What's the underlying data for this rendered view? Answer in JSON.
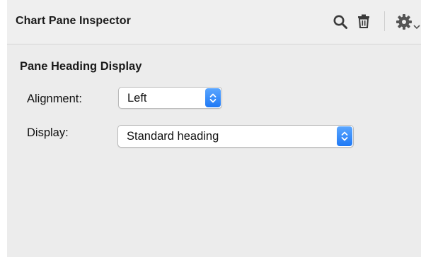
{
  "inspector": {
    "title": "Chart Pane Inspector"
  },
  "toolbar": {
    "icons": [
      "search-icon",
      "trash-icon",
      "gear-icon",
      "chevron-down-icon"
    ]
  },
  "section": {
    "title": "Pane Heading Display"
  },
  "fields": {
    "alignment": {
      "label": "Alignment:",
      "value": "Left"
    },
    "display": {
      "label": "Display:",
      "value": "Standard heading"
    }
  },
  "colors": {
    "panel_background": "#ececec",
    "popup_accent": "#1f79f5"
  }
}
